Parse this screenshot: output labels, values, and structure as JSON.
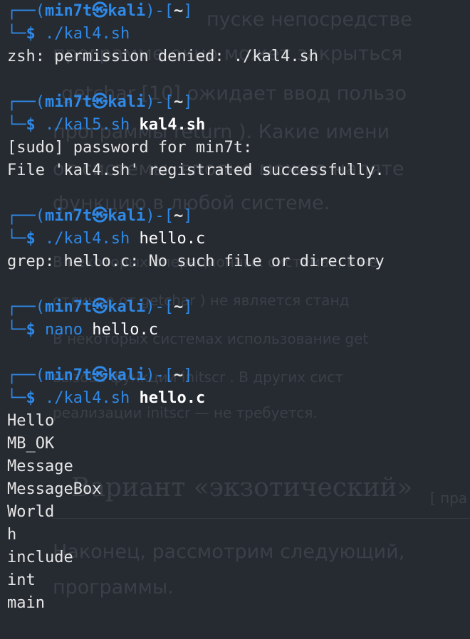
{
  "background_text": [
    "пуске непосредстве",
    "программе окно может закрыться",
    "getchar [10] ожидает ввод пользо",
    "программы return ). Какие имени",
    "от системы, вполне можно наляте",
    "функцию в любой системе.",
    "В некоторых операционных системах, в не",
    "отличие от getchar ) не является станд",
    "В некоторых системах использование get",
    "вызова функции initscr . В других сист",
    "реализации initscr — не требуется.",
    "Вариант «экзотический»",
    "[ пра",
    "Наконец, рассмотрим следующий,",
    "программы."
  ],
  "prompt": {
    "corner_top": "┌──",
    "corner_bottom": "└─",
    "user": "min7t",
    "at_symbol": "㉿",
    "host": "kali",
    "dir": "~",
    "dollar": "$"
  },
  "blocks": [
    {
      "command": "./kal4.sh",
      "args": "",
      "args_bold": false,
      "output": [
        "zsh: permission denied: ./kal4.sh"
      ]
    },
    {
      "command": "./kal5.sh",
      "args": "kal4.sh",
      "args_bold": true,
      "output": [
        "[sudo] password for min7t:",
        "File 'kal4.sh' registrated successfully."
      ]
    },
    {
      "command": "./kal4.sh",
      "args": "hello.c",
      "args_bold": false,
      "output": [
        "grep: hello.c: No such file or directory"
      ]
    },
    {
      "command": "nano",
      "args": "hello.c",
      "args_bold": false,
      "output": []
    },
    {
      "command": "./kal4.sh",
      "args": "hello.c",
      "args_bold": true,
      "output": [
        "Hello",
        "MB_OK",
        "Message",
        "MessageBox",
        "World",
        "h",
        "include",
        "int",
        "main"
      ]
    }
  ]
}
